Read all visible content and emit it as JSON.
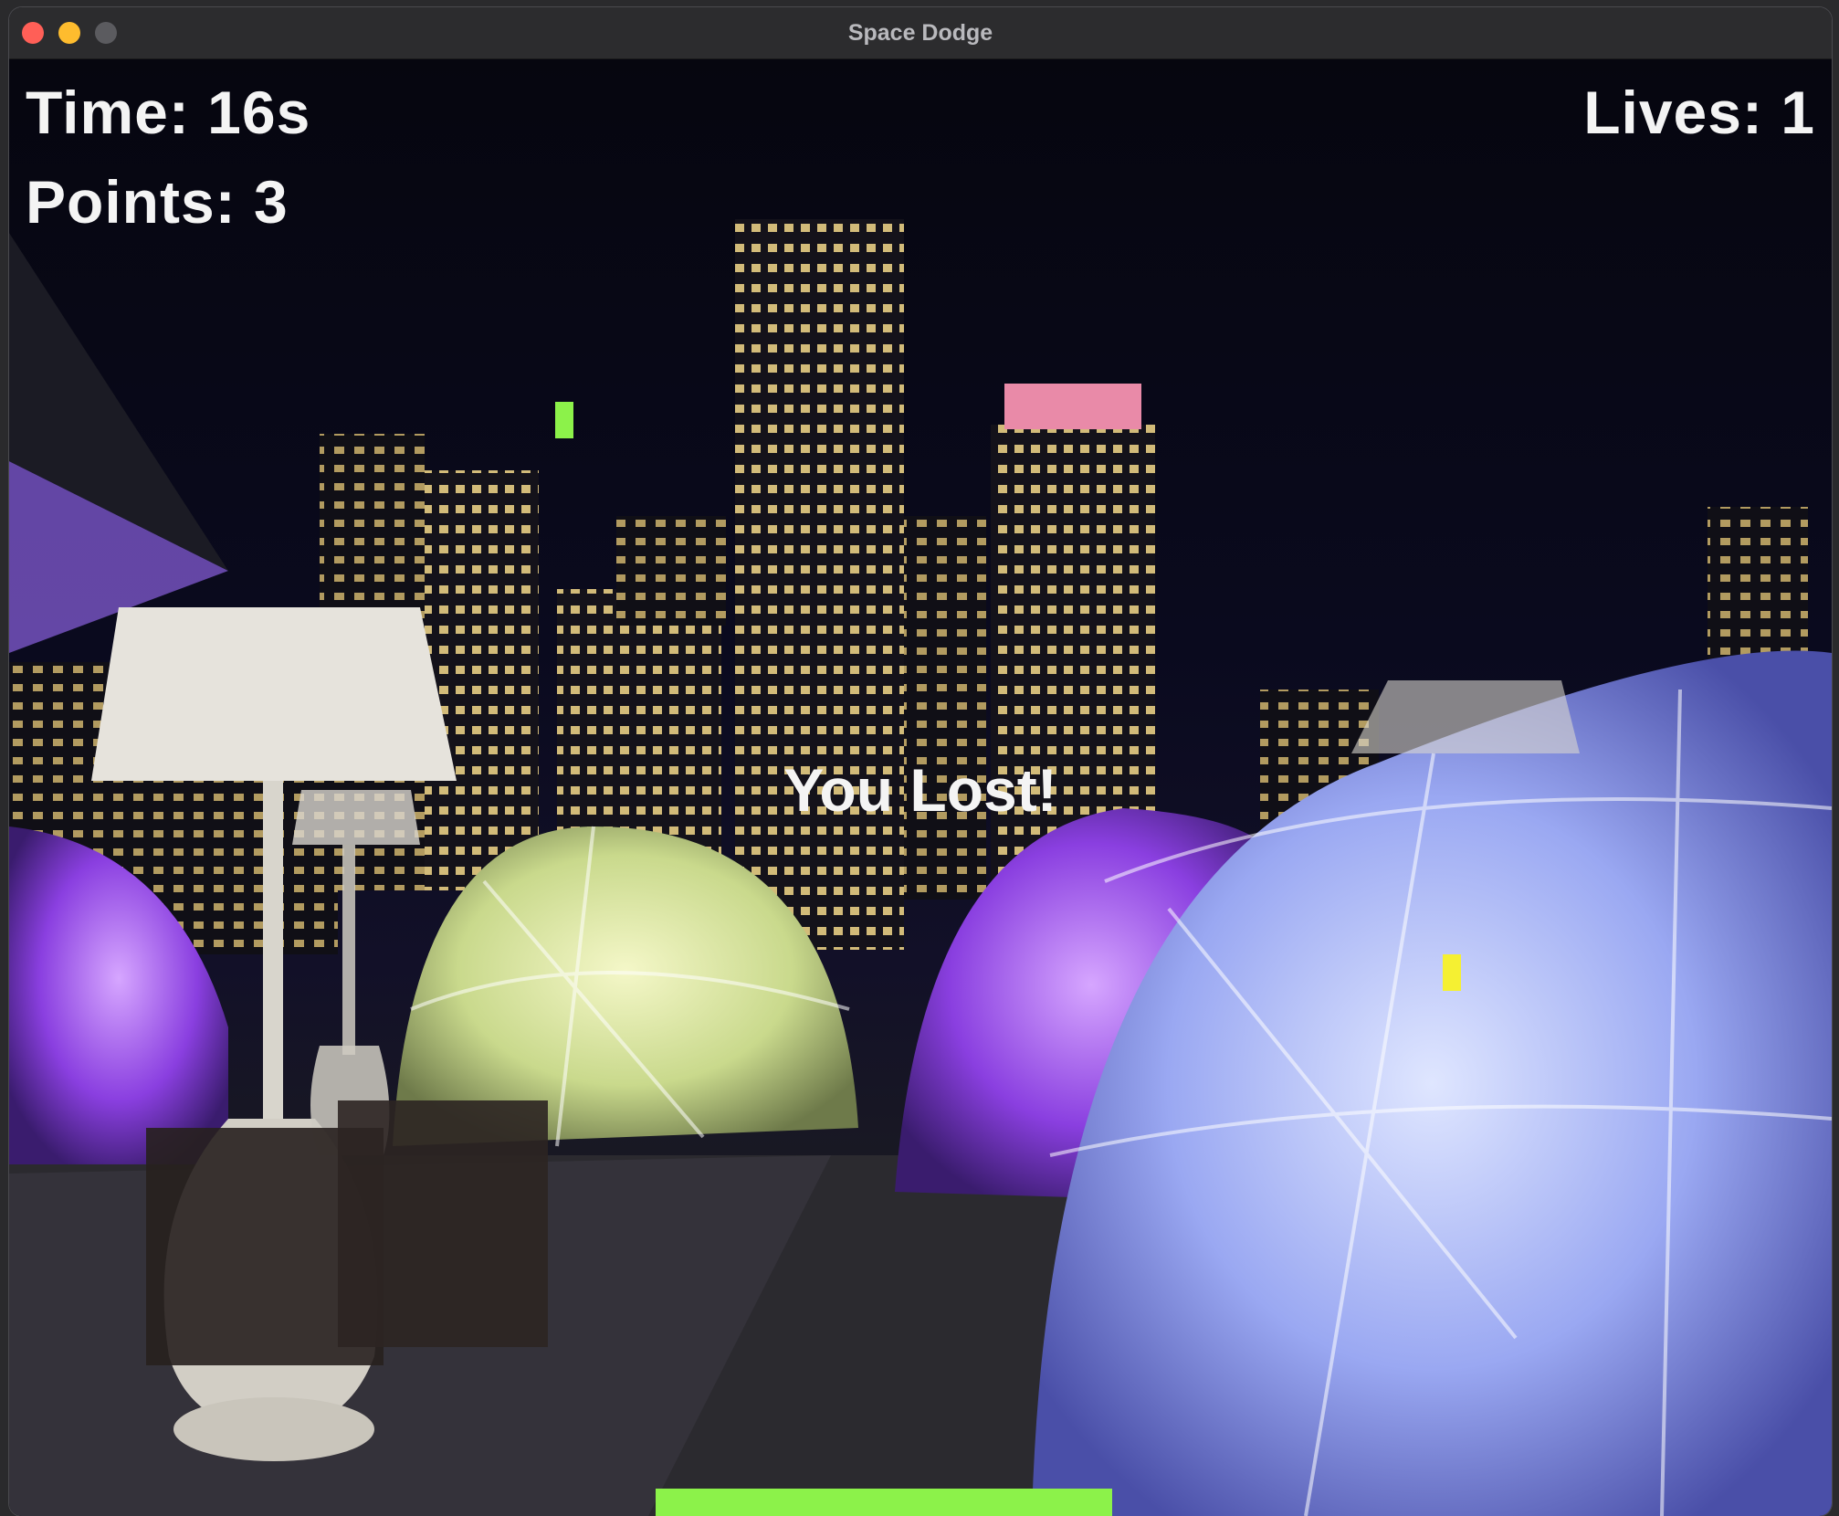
{
  "window": {
    "title": "Space Dodge"
  },
  "hud": {
    "time_text": "Time: 16s",
    "points_text": "Points: 3",
    "lives_text": "Lives: 1"
  },
  "message": "You Lost!",
  "colors": {
    "player": "#8cf24a",
    "projectile_green": "#8cf24a",
    "projectile_yellow": "#f5f032",
    "hud_text": "#f4f4f4"
  }
}
